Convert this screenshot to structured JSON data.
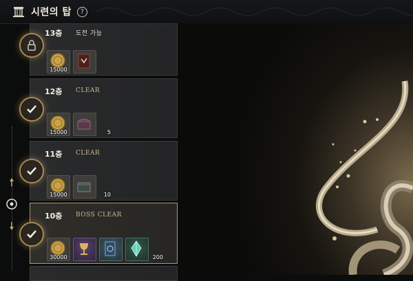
{
  "header": {
    "title": "시련의 탑",
    "help_label": "?",
    "tower_icon": "tower-icon",
    "help_icon": "help-circle-icon"
  },
  "floors": [
    {
      "name": "13층",
      "status": "도전 가능",
      "badge_icon": "lock-icon",
      "rewards": [
        {
          "icon": "gold-coin-icon",
          "qty": "15000"
        },
        {
          "icon": "rune-book-icon",
          "qty": ""
        }
      ]
    },
    {
      "name": "12층",
      "status": "CLEAR",
      "badge_icon": "check-icon",
      "rewards": [
        {
          "icon": "gold-coin-icon",
          "qty": "15000"
        },
        {
          "icon": "treasure-chest-icon",
          "qty": "5"
        }
      ]
    },
    {
      "name": "11층",
      "status": "CLEAR",
      "badge_icon": "check-icon",
      "rewards": [
        {
          "icon": "gold-coin-icon",
          "qty": "15000"
        },
        {
          "icon": "iron-chest-icon",
          "qty": "10"
        }
      ]
    },
    {
      "name": "10층",
      "status": "BOSS CLEAR",
      "badge_icon": "check-icon",
      "rewards": [
        {
          "icon": "gold-coin-icon",
          "qty": "30000"
        },
        {
          "icon": "golden-chalice-icon",
          "qty": ""
        },
        {
          "icon": "blue-card-icon",
          "qty": ""
        },
        {
          "icon": "crystal-icon",
          "qty": "200"
        }
      ]
    }
  ],
  "colors": {
    "accent_gold": "#b19a66",
    "clear_text": "#c9b98e",
    "background": "#0b0c0c"
  }
}
